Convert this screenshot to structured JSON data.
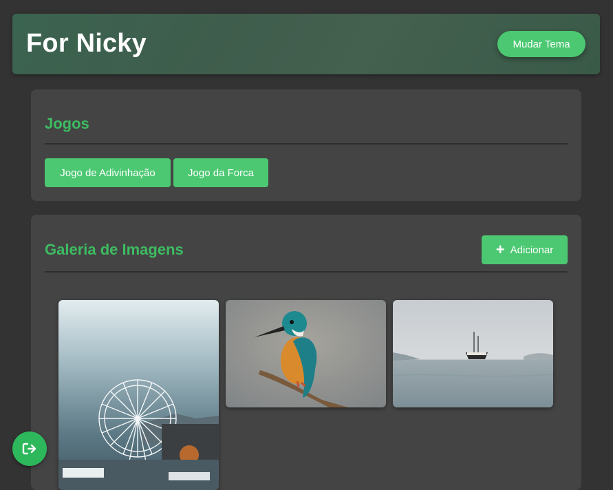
{
  "header": {
    "title": "For Nicky",
    "theme_button": "Mudar Tema"
  },
  "games": {
    "title": "Jogos",
    "buttons": [
      "Jogo de Adivinhação",
      "Jogo da Forca"
    ]
  },
  "gallery": {
    "title": "Galeria de Imagens",
    "add_button": "Adicionar",
    "images": [
      {
        "subject": "ferris-wheel"
      },
      {
        "subject": "kingfisher-bird"
      },
      {
        "subject": "ship-at-sea"
      }
    ]
  },
  "colors": {
    "accent": "#4cc872",
    "title_green": "#3dbc62",
    "background": "#333333",
    "card": "#444444"
  },
  "icons": {
    "add": "plus-icon",
    "logout": "logout-icon"
  }
}
